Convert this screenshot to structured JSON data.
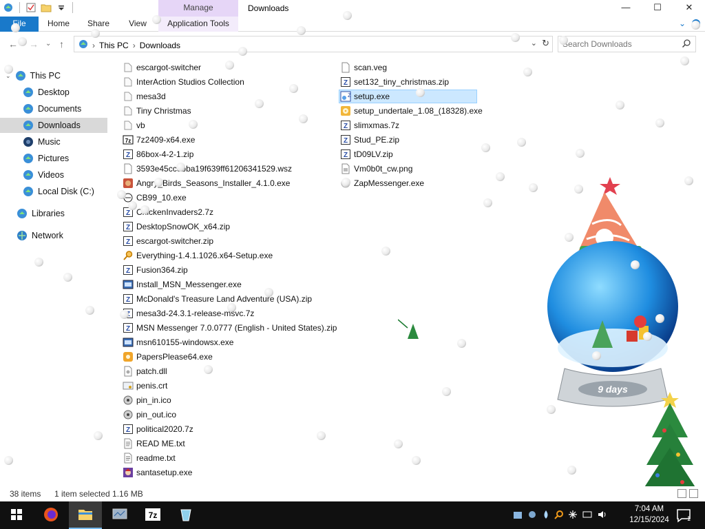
{
  "window": {
    "title": "Downloads",
    "context_tab": "Manage",
    "controls": {
      "minimize": "—",
      "maximize": "☐",
      "close": "✕"
    }
  },
  "ribbon": {
    "tabs": [
      "File",
      "Home",
      "Share",
      "View",
      "Application Tools"
    ]
  },
  "address": {
    "crumbs": [
      "This PC",
      "Downloads"
    ]
  },
  "search": {
    "placeholder": "Search Downloads"
  },
  "nav": {
    "items": [
      {
        "label": "This PC",
        "icon": "computer-icon",
        "level": 0
      },
      {
        "label": "Desktop",
        "icon": "desktop-icon",
        "level": 1
      },
      {
        "label": "Documents",
        "icon": "documents-icon",
        "level": 1
      },
      {
        "label": "Downloads",
        "icon": "downloads-icon",
        "level": 1,
        "selected": true
      },
      {
        "label": "Music",
        "icon": "music-icon",
        "level": 1
      },
      {
        "label": "Pictures",
        "icon": "pictures-icon",
        "level": 1
      },
      {
        "label": "Videos",
        "icon": "videos-icon",
        "level": 1
      },
      {
        "label": "Local Disk (C:)",
        "icon": "disk-icon",
        "level": 1
      },
      {
        "label": "Libraries",
        "icon": "libraries-icon",
        "level": 0
      },
      {
        "label": "Network",
        "icon": "network-icon",
        "level": 0
      }
    ]
  },
  "files": {
    "column1": [
      {
        "name": "escargot-switcher",
        "icon": "folder-icon"
      },
      {
        "name": "InterAction Studios Collection",
        "icon": "folder-icon"
      },
      {
        "name": "mesa3d",
        "icon": "folder-icon"
      },
      {
        "name": "Tiny Christmas",
        "icon": "folder-icon"
      },
      {
        "name": "vb",
        "icon": "folder-icon"
      },
      {
        "name": "7z2409-x64.exe",
        "icon": "7zip-icon"
      },
      {
        "name": "86box-4-2-1.zip",
        "icon": "archive-icon"
      },
      {
        "name": "3593e45ccebba19f639ff61206341529.wsz",
        "icon": "file-icon"
      },
      {
        "name": "Angry_Birds_Seasons_Installer_4.1.0.exe",
        "icon": "bird-icon"
      },
      {
        "name": "CB99_10.exe",
        "icon": "app-icon"
      },
      {
        "name": "ChickenInvaders2.7z",
        "icon": "archive-icon"
      },
      {
        "name": "DesktopSnowOK_x64.zip",
        "icon": "archive-icon"
      },
      {
        "name": "escargot-switcher.zip",
        "icon": "archive-icon"
      },
      {
        "name": "Everything-1.4.1.1026.x64-Setup.exe",
        "icon": "magnifier-icon"
      },
      {
        "name": "Fusion364.zip",
        "icon": "archive-icon"
      },
      {
        "name": "Install_MSN_Messenger.exe",
        "icon": "installer-icon"
      },
      {
        "name": "McDonald's Treasure Land Adventure (USA).zip",
        "icon": "archive-icon"
      },
      {
        "name": "mesa3d-24.3.1-release-msvc.7z",
        "icon": "archive-icon"
      },
      {
        "name": "MSN Messenger 7.0.0777 (English - United States).zip",
        "icon": "archive-icon"
      },
      {
        "name": "msn610155-windowsx.exe",
        "icon": "installer-icon"
      },
      {
        "name": "PapersPlease64.exe",
        "icon": "papers-icon"
      },
      {
        "name": "patch.dll",
        "icon": "dll-icon"
      },
      {
        "name": "penis.crt",
        "icon": "certificate-icon"
      },
      {
        "name": "pin_in.ico",
        "icon": "ico-icon"
      },
      {
        "name": "pin_out.ico",
        "icon": "ico-icon"
      },
      {
        "name": "political2020.7z",
        "icon": "archive-icon"
      },
      {
        "name": "READ ME.txt",
        "icon": "text-icon"
      },
      {
        "name": "readme.txt",
        "icon": "text-icon"
      },
      {
        "name": "santasetup.exe",
        "icon": "santa-icon"
      }
    ],
    "column2": [
      {
        "name": "scan.veg",
        "icon": "file-icon"
      },
      {
        "name": "set132_tiny_christmas.zip",
        "icon": "archive-icon"
      },
      {
        "name": "setup.exe",
        "icon": "setup-icon",
        "selected": true
      },
      {
        "name": "setup_undertale_1.08_(18328).exe",
        "icon": "disc-icon"
      },
      {
        "name": "slimxmas.7z",
        "icon": "archive-icon"
      },
      {
        "name": "Stud_PE.zip",
        "icon": "archive-icon"
      },
      {
        "name": "tD09LV.zip",
        "icon": "archive-icon"
      },
      {
        "name": "Vm0b0t_cw.png",
        "icon": "image-icon"
      },
      {
        "name": "ZapMessenger.exe",
        "icon": "zap-icon"
      }
    ]
  },
  "status": {
    "count": "38 items",
    "selection": "1 item selected  1.16 MB"
  },
  "desktop": {
    "globe_label": "9 days"
  },
  "taskbar": {
    "apps": [
      "start-icon",
      "firefox-icon",
      "explorer-icon",
      "monitor-app-icon",
      "7zip-taskbar-icon",
      "bucket-app-icon"
    ],
    "time": "7:04 AM",
    "date": "12/15/2024",
    "notification_count": "1"
  },
  "colors": {
    "accent": "#1979ca",
    "selection": "#cce8ff",
    "manage_tab": "#e6d6f7",
    "taskbar": "#101010"
  }
}
